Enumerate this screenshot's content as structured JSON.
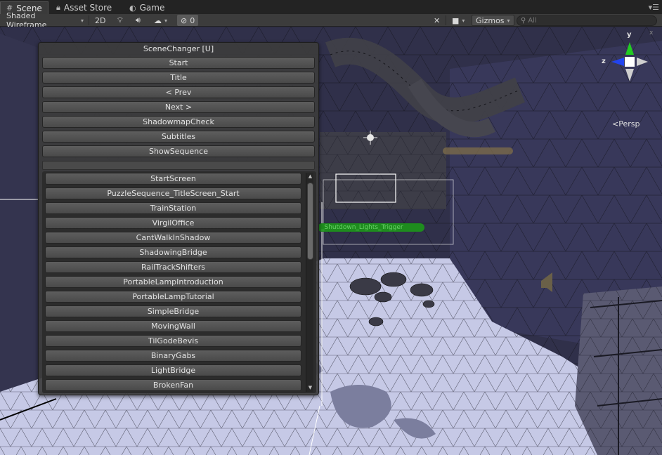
{
  "tabs": [
    {
      "label": "Scene",
      "icon": "grid-icon"
    },
    {
      "label": "Asset Store",
      "icon": "lock-icon"
    },
    {
      "label": "Game",
      "icon": "game-icon"
    }
  ],
  "toolbar": {
    "shading_mode": "Shaded Wireframe",
    "mode_2d": "2D",
    "hidden_count": "0",
    "gizmos_label": "Gizmos",
    "search_placeholder": "All"
  },
  "scene": {
    "persp_label": "Persp",
    "axis_x": "x",
    "axis_y": "y",
    "axis_z": "z",
    "trigger_label": "_Shutdown_Lights_Trigger",
    "colors": {
      "background": "#2e2e46",
      "floor": "#c8cbe8",
      "wire": "#000000",
      "trigger": "#1e8c1e"
    }
  },
  "scene_changer": {
    "title": "SceneChanger [U]",
    "top_buttons": [
      "Start",
      "Title",
      "< Prev",
      "Next >",
      "ShadowmapCheck",
      "Subtitles",
      "ShowSequence"
    ],
    "scene_list": [
      "StartScreen",
      "PuzzleSequence_TitleScreen_Start",
      "TrainStation",
      "VirgilOffice",
      "CantWalkInShadow",
      "ShadowingBridge",
      "RailTrackShifters",
      "PortableLampIntroduction",
      "PortableLampTutorial",
      "SimpleBridge",
      "MovingWall",
      "TilGodeBevis",
      "BinaryGabs",
      "LightBridge",
      "BrokenFan"
    ]
  }
}
